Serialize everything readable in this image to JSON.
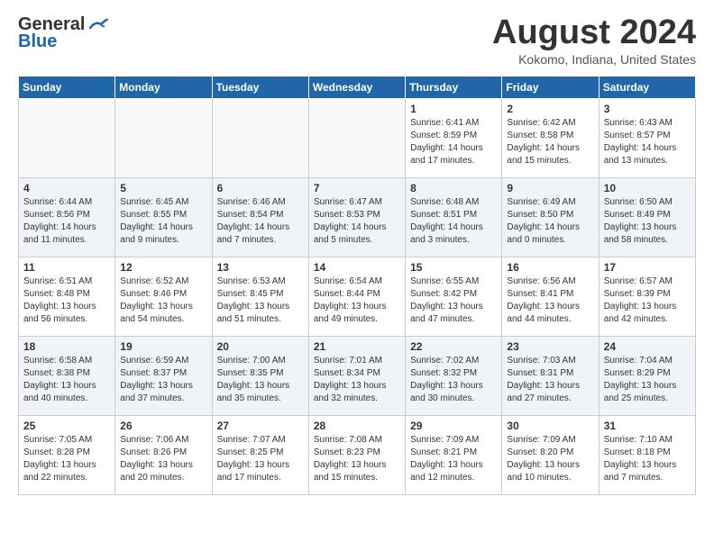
{
  "header": {
    "logo_line1": "General",
    "logo_line2": "Blue",
    "month_title": "August 2024",
    "location": "Kokomo, Indiana, United States"
  },
  "weekdays": [
    "Sunday",
    "Monday",
    "Tuesday",
    "Wednesday",
    "Thursday",
    "Friday",
    "Saturday"
  ],
  "weeks": [
    [
      {
        "day": "",
        "sunrise": "",
        "sunset": "",
        "daylight": ""
      },
      {
        "day": "",
        "sunrise": "",
        "sunset": "",
        "daylight": ""
      },
      {
        "day": "",
        "sunrise": "",
        "sunset": "",
        "daylight": ""
      },
      {
        "day": "",
        "sunrise": "",
        "sunset": "",
        "daylight": ""
      },
      {
        "day": "1",
        "sunrise": "Sunrise: 6:41 AM",
        "sunset": "Sunset: 8:59 PM",
        "daylight": "Daylight: 14 hours and 17 minutes."
      },
      {
        "day": "2",
        "sunrise": "Sunrise: 6:42 AM",
        "sunset": "Sunset: 8:58 PM",
        "daylight": "Daylight: 14 hours and 15 minutes."
      },
      {
        "day": "3",
        "sunrise": "Sunrise: 6:43 AM",
        "sunset": "Sunset: 8:57 PM",
        "daylight": "Daylight: 14 hours and 13 minutes."
      }
    ],
    [
      {
        "day": "4",
        "sunrise": "Sunrise: 6:44 AM",
        "sunset": "Sunset: 8:56 PM",
        "daylight": "Daylight: 14 hours and 11 minutes."
      },
      {
        "day": "5",
        "sunrise": "Sunrise: 6:45 AM",
        "sunset": "Sunset: 8:55 PM",
        "daylight": "Daylight: 14 hours and 9 minutes."
      },
      {
        "day": "6",
        "sunrise": "Sunrise: 6:46 AM",
        "sunset": "Sunset: 8:54 PM",
        "daylight": "Daylight: 14 hours and 7 minutes."
      },
      {
        "day": "7",
        "sunrise": "Sunrise: 6:47 AM",
        "sunset": "Sunset: 8:53 PM",
        "daylight": "Daylight: 14 hours and 5 minutes."
      },
      {
        "day": "8",
        "sunrise": "Sunrise: 6:48 AM",
        "sunset": "Sunset: 8:51 PM",
        "daylight": "Daylight: 14 hours and 3 minutes."
      },
      {
        "day": "9",
        "sunrise": "Sunrise: 6:49 AM",
        "sunset": "Sunset: 8:50 PM",
        "daylight": "Daylight: 14 hours and 0 minutes."
      },
      {
        "day": "10",
        "sunrise": "Sunrise: 6:50 AM",
        "sunset": "Sunset: 8:49 PM",
        "daylight": "Daylight: 13 hours and 58 minutes."
      }
    ],
    [
      {
        "day": "11",
        "sunrise": "Sunrise: 6:51 AM",
        "sunset": "Sunset: 8:48 PM",
        "daylight": "Daylight: 13 hours and 56 minutes."
      },
      {
        "day": "12",
        "sunrise": "Sunrise: 6:52 AM",
        "sunset": "Sunset: 8:46 PM",
        "daylight": "Daylight: 13 hours and 54 minutes."
      },
      {
        "day": "13",
        "sunrise": "Sunrise: 6:53 AM",
        "sunset": "Sunset: 8:45 PM",
        "daylight": "Daylight: 13 hours and 51 minutes."
      },
      {
        "day": "14",
        "sunrise": "Sunrise: 6:54 AM",
        "sunset": "Sunset: 8:44 PM",
        "daylight": "Daylight: 13 hours and 49 minutes."
      },
      {
        "day": "15",
        "sunrise": "Sunrise: 6:55 AM",
        "sunset": "Sunset: 8:42 PM",
        "daylight": "Daylight: 13 hours and 47 minutes."
      },
      {
        "day": "16",
        "sunrise": "Sunrise: 6:56 AM",
        "sunset": "Sunset: 8:41 PM",
        "daylight": "Daylight: 13 hours and 44 minutes."
      },
      {
        "day": "17",
        "sunrise": "Sunrise: 6:57 AM",
        "sunset": "Sunset: 8:39 PM",
        "daylight": "Daylight: 13 hours and 42 minutes."
      }
    ],
    [
      {
        "day": "18",
        "sunrise": "Sunrise: 6:58 AM",
        "sunset": "Sunset: 8:38 PM",
        "daylight": "Daylight: 13 hours and 40 minutes."
      },
      {
        "day": "19",
        "sunrise": "Sunrise: 6:59 AM",
        "sunset": "Sunset: 8:37 PM",
        "daylight": "Daylight: 13 hours and 37 minutes."
      },
      {
        "day": "20",
        "sunrise": "Sunrise: 7:00 AM",
        "sunset": "Sunset: 8:35 PM",
        "daylight": "Daylight: 13 hours and 35 minutes."
      },
      {
        "day": "21",
        "sunrise": "Sunrise: 7:01 AM",
        "sunset": "Sunset: 8:34 PM",
        "daylight": "Daylight: 13 hours and 32 minutes."
      },
      {
        "day": "22",
        "sunrise": "Sunrise: 7:02 AM",
        "sunset": "Sunset: 8:32 PM",
        "daylight": "Daylight: 13 hours and 30 minutes."
      },
      {
        "day": "23",
        "sunrise": "Sunrise: 7:03 AM",
        "sunset": "Sunset: 8:31 PM",
        "daylight": "Daylight: 13 hours and 27 minutes."
      },
      {
        "day": "24",
        "sunrise": "Sunrise: 7:04 AM",
        "sunset": "Sunset: 8:29 PM",
        "daylight": "Daylight: 13 hours and 25 minutes."
      }
    ],
    [
      {
        "day": "25",
        "sunrise": "Sunrise: 7:05 AM",
        "sunset": "Sunset: 8:28 PM",
        "daylight": "Daylight: 13 hours and 22 minutes."
      },
      {
        "day": "26",
        "sunrise": "Sunrise: 7:06 AM",
        "sunset": "Sunset: 8:26 PM",
        "daylight": "Daylight: 13 hours and 20 minutes."
      },
      {
        "day": "27",
        "sunrise": "Sunrise: 7:07 AM",
        "sunset": "Sunset: 8:25 PM",
        "daylight": "Daylight: 13 hours and 17 minutes."
      },
      {
        "day": "28",
        "sunrise": "Sunrise: 7:08 AM",
        "sunset": "Sunset: 8:23 PM",
        "daylight": "Daylight: 13 hours and 15 minutes."
      },
      {
        "day": "29",
        "sunrise": "Sunrise: 7:09 AM",
        "sunset": "Sunset: 8:21 PM",
        "daylight": "Daylight: 13 hours and 12 minutes."
      },
      {
        "day": "30",
        "sunrise": "Sunrise: 7:09 AM",
        "sunset": "Sunset: 8:20 PM",
        "daylight": "Daylight: 13 hours and 10 minutes."
      },
      {
        "day": "31",
        "sunrise": "Sunrise: 7:10 AM",
        "sunset": "Sunset: 8:18 PM",
        "daylight": "Daylight: 13 hours and 7 minutes."
      }
    ]
  ]
}
